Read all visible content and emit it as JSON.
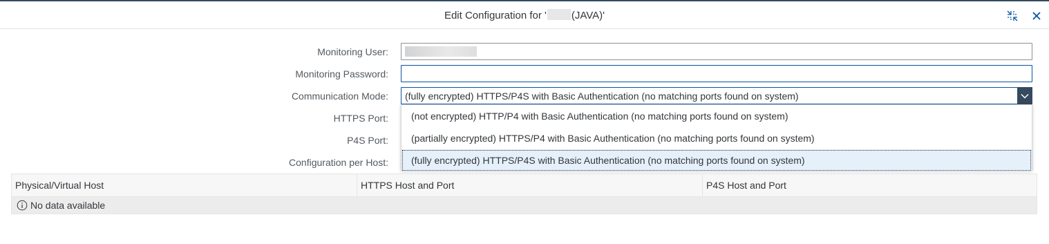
{
  "dialog": {
    "title_prefix": "Edit Configuration for '",
    "title_suffix": "(JAVA)'",
    "exit_fullscreen_icon": "exit-fullscreen-icon",
    "close_icon": "close-icon"
  },
  "form": {
    "monitoring_user_label": "Monitoring User:",
    "monitoring_password_label": "Monitoring Password:",
    "communication_mode_label": "Communication Mode:",
    "https_port_label": "HTTPS Port:",
    "p4s_port_label": "P4S Port:",
    "config_per_host_label": "Configuration per Host:",
    "communication_mode_value": "(fully encrypted) HTTPS/P4S with Basic Authentication (no matching ports found on system)"
  },
  "dropdown": {
    "options": [
      "(not encrypted) HTTP/P4 with Basic Authentication (no matching ports found on system)",
      "(partially encrypted) HTTPS/P4 with Basic Authentication (no matching ports found on system)",
      "(fully encrypted) HTTPS/P4S with Basic Authentication (no matching ports found on system)"
    ],
    "selected_index": 2
  },
  "table": {
    "columns": [
      "Physical/Virtual Host",
      "HTTPS Host and Port",
      "P4S Host and Port"
    ],
    "no_data_text": "No data available"
  },
  "colors": {
    "header_bar": "#354a5f",
    "focus_border": "#0854a0",
    "selected_option_bg": "#e5f0fa"
  }
}
